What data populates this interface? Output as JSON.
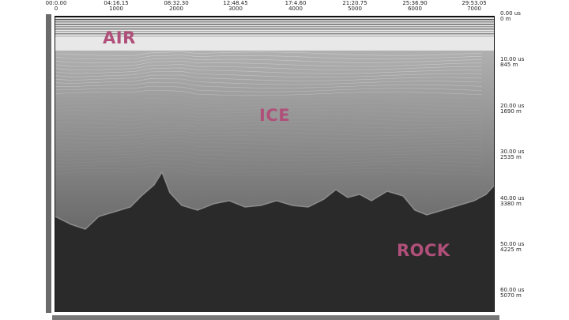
{
  "radargram": {
    "time_axis_top": [
      {
        "time": "00:0.00",
        "trace": "0"
      },
      {
        "time": "04:16.15",
        "trace": "1000"
      },
      {
        "time": "08:32.30",
        "trace": "2000"
      },
      {
        "time": "12:48.45",
        "trace": "3000"
      },
      {
        "time": "17:4.60",
        "trace": "4000"
      },
      {
        "time": "21:20.75",
        "trace": "5000"
      },
      {
        "time": "25:36.90",
        "trace": "6000"
      },
      {
        "time": "29:53.05",
        "trace": "7000"
      }
    ],
    "depth_axis_right": [
      {
        "twt": "0.00 us",
        "depth": "0 m"
      },
      {
        "twt": "10.00 us",
        "depth": "845 m"
      },
      {
        "twt": "20.00 us",
        "depth": "1690 m"
      },
      {
        "twt": "30.00 us",
        "depth": "2535 m"
      },
      {
        "twt": "40.00 us",
        "depth": "3380 m"
      },
      {
        "twt": "50.00 us",
        "depth": "4225 m"
      },
      {
        "twt": "60.00 us",
        "depth": "5070 m"
      }
    ],
    "region_labels": {
      "air": "AIR",
      "ice": "ICE",
      "rock": "ROCK"
    },
    "colors": {
      "label": "#b0507a",
      "air": "#e8e8e8",
      "ice_top": "#bdbdbd",
      "ice_bottom": "#6a6a6a",
      "rock": "#2a2a2a"
    }
  }
}
